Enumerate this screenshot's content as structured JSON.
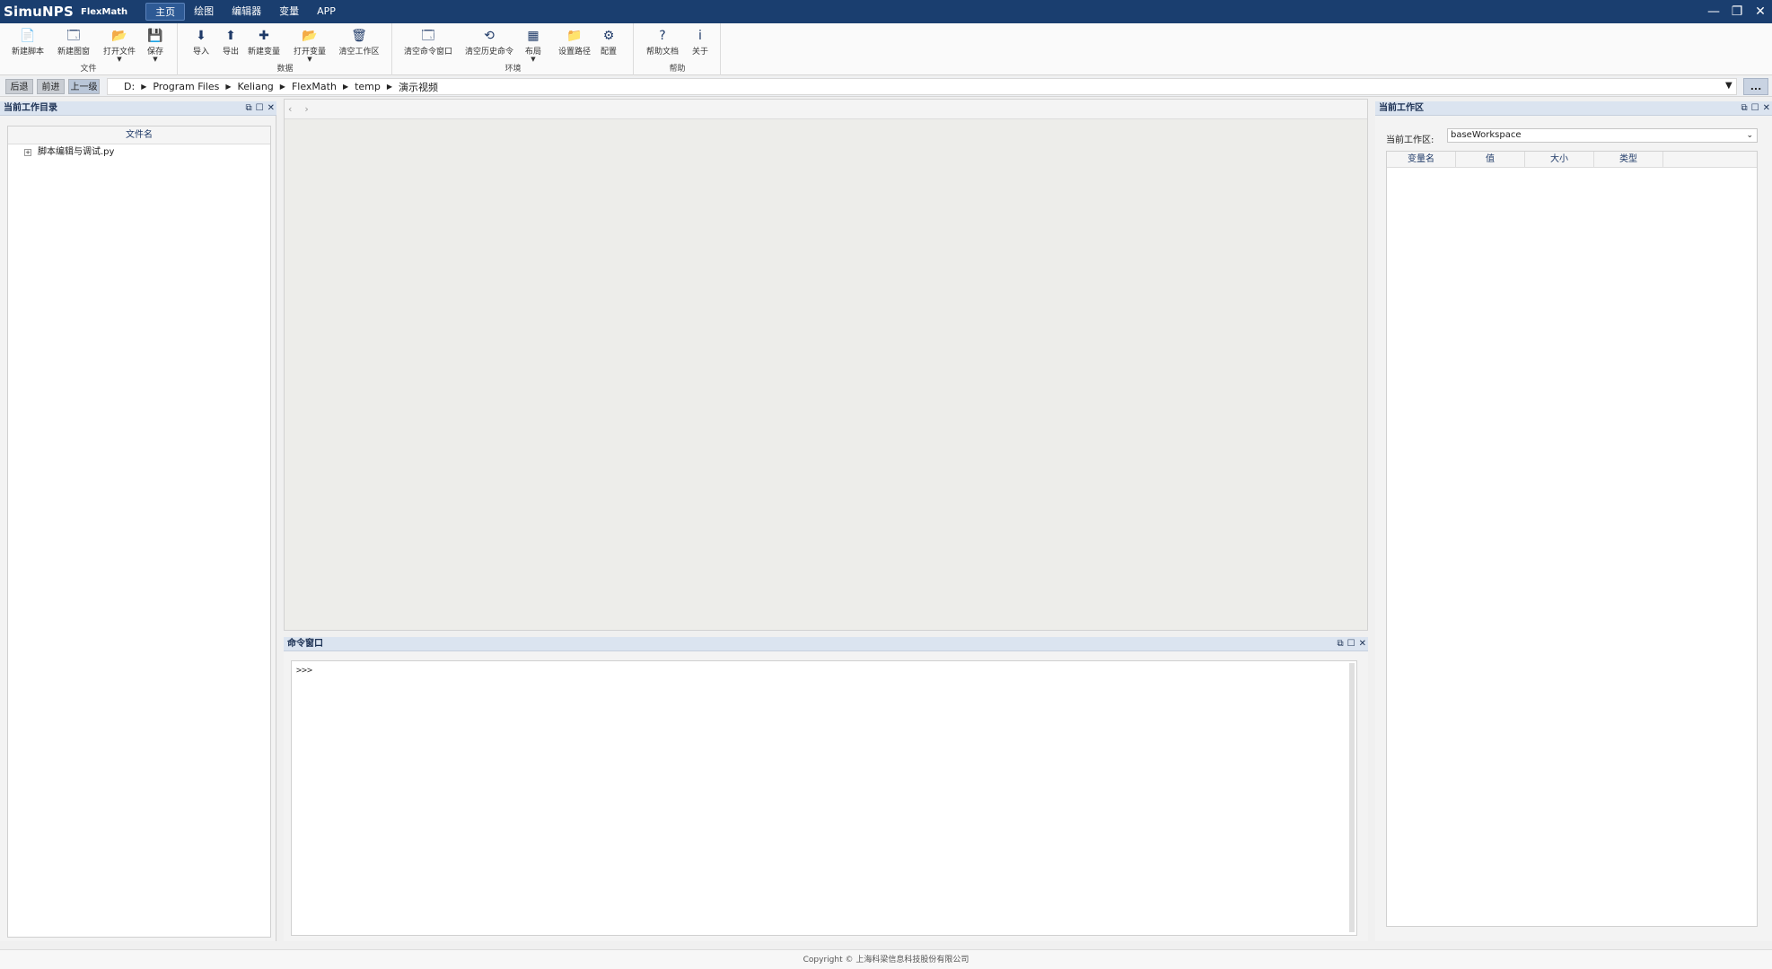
{
  "app": {
    "brand": "SimuNPS",
    "product": "FlexMath",
    "menu": [
      "主页",
      "绘图",
      "编辑器",
      "变量",
      "APP"
    ],
    "window_controls": [
      "—",
      "❐",
      "✕"
    ]
  },
  "ribbon": {
    "groups": [
      {
        "title": "文件",
        "buttons": [
          {
            "label": "新建脚本",
            "icon": "new-script-icon",
            "glyph": "📄"
          },
          {
            "label": "新建图窗",
            "icon": "new-figure-icon",
            "glyph": "🗔"
          },
          {
            "label": "打开文件",
            "icon": "open-file-icon",
            "glyph": "📂",
            "caret": true
          },
          {
            "label": "保存",
            "icon": "save-icon",
            "glyph": "💾",
            "caret": true
          }
        ]
      },
      {
        "title": "数据",
        "buttons": [
          {
            "label": "导入",
            "icon": "import-icon",
            "glyph": "⬇"
          },
          {
            "label": "导出",
            "icon": "export-icon",
            "glyph": "⬆"
          },
          {
            "label": "新建变量",
            "icon": "new-variable-icon",
            "glyph": "✚"
          },
          {
            "label": "打开变量",
            "icon": "open-variable-icon",
            "glyph": "📂",
            "caret": true
          },
          {
            "label": "清空工作区",
            "icon": "clear-workspace-icon",
            "glyph": "🗑"
          }
        ]
      },
      {
        "title": "环境",
        "buttons": [
          {
            "label": "清空命令窗口",
            "icon": "clear-command-window-icon",
            "glyph": "🗔"
          },
          {
            "label": "清空历史命令",
            "icon": "clear-history-icon",
            "glyph": "⟲"
          },
          {
            "label": "布局",
            "icon": "layout-icon",
            "glyph": "▦",
            "caret": true
          },
          {
            "label": "设置路径",
            "icon": "set-path-icon",
            "glyph": "📁"
          },
          {
            "label": "配置",
            "icon": "settings-gear-icon",
            "glyph": "⚙"
          }
        ]
      },
      {
        "title": "帮助",
        "buttons": [
          {
            "label": "帮助文档",
            "icon": "help-icon",
            "glyph": "?"
          },
          {
            "label": "关于",
            "icon": "about-info-icon",
            "glyph": "i"
          }
        ]
      }
    ]
  },
  "nav": {
    "back": "后退",
    "forward": "前进",
    "up": "上一级",
    "path": [
      "D:",
      "Program Files",
      "Keliang",
      "FlexMath",
      "temp",
      "演示视频"
    ],
    "more": "..."
  },
  "left_panel": {
    "title": "当前工作目录",
    "column_header": "文件名",
    "files": [
      {
        "name": "脚本编辑与调试.py",
        "expander": "+"
      }
    ]
  },
  "doc_area": {
    "nav_prev": "‹",
    "nav_next": "›"
  },
  "command_window": {
    "title": "命令窗口",
    "prompt": ">>>"
  },
  "right_panel": {
    "title": "当前工作区",
    "workspace_label": "当前工作区:",
    "workspace_value": "baseWorkspace",
    "columns": [
      "变量名",
      "值",
      "大小",
      "类型"
    ]
  },
  "status": {
    "copyright": "Copyright © 上海科梁信息科技股份有限公司"
  },
  "panel_controls": [
    "⧉",
    "☐",
    "✕"
  ]
}
